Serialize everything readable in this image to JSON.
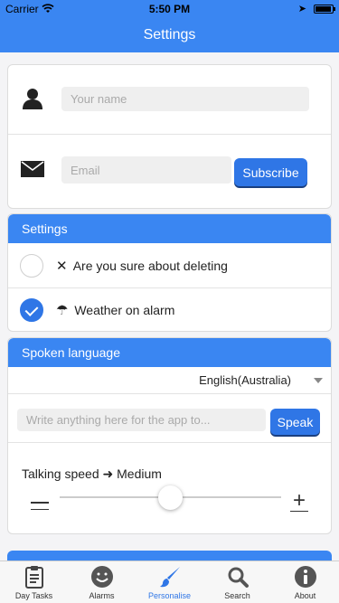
{
  "status_bar": {
    "carrier": "Carrier",
    "time": "5:50 PM"
  },
  "nav": {
    "title": "Settings"
  },
  "profile": {
    "name_placeholder": "Your name",
    "email_placeholder": "Email",
    "subscribe_label": "Subscribe"
  },
  "settings": {
    "header": "Settings",
    "items": [
      {
        "glyph": "✕",
        "label": "Are you sure about deleting",
        "checked": false
      },
      {
        "glyph": "☂",
        "label": "Weather on alarm",
        "checked": true
      }
    ]
  },
  "language": {
    "header": "Spoken language",
    "selected": "English(Australia)",
    "speak_placeholder": "Write anything here for the app to...",
    "speak_label": "Speak",
    "speed_label": "Talking speed",
    "speed_arrow": "➜",
    "speed_value": "Medium",
    "speed_level": 0.5
  },
  "tabs": [
    {
      "label": "Day Tasks",
      "icon": "clipboard-icon"
    },
    {
      "label": "Alarms",
      "icon": "smiley-icon"
    },
    {
      "label": "Personalise",
      "icon": "brush-icon",
      "active": true
    },
    {
      "label": "Search",
      "icon": "search-icon"
    },
    {
      "label": "About",
      "icon": "info-icon"
    }
  ],
  "colors": {
    "accent": "#3a86f2",
    "button": "#2f76e6"
  }
}
